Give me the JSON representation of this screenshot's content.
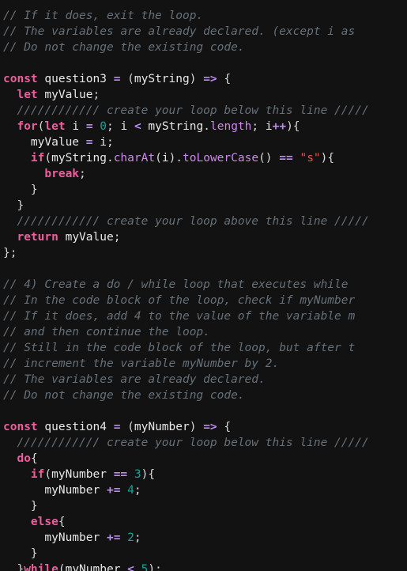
{
  "editor": {
    "background": "#121212",
    "default_text_color": "#d6d6d6",
    "font_size_px": 14.5,
    "line_height_px": 20,
    "theme_colors": {
      "comment": "#667079",
      "keyword": "#ef5d9e",
      "identifier": "#e8e8e8",
      "property": "#c98ae8",
      "operator": "#bb8cf0",
      "number": "#0fa69c",
      "string": "#e2574d",
      "punctuation": "#d8d8d8"
    },
    "lines": [
      {
        "n": 1,
        "indent": 0,
        "tokens": [
          {
            "t": "cmt",
            "v": "// If it does, exit the loop."
          }
        ]
      },
      {
        "n": 2,
        "indent": 0,
        "tokens": [
          {
            "t": "cmt",
            "v": "// The variables are already declared. (except i as"
          }
        ]
      },
      {
        "n": 3,
        "indent": 0,
        "tokens": [
          {
            "t": "cmt",
            "v": "// Do not change the existing code."
          }
        ]
      },
      {
        "n": 4,
        "indent": 0,
        "tokens": []
      },
      {
        "n": 5,
        "indent": 0,
        "tokens": [
          {
            "t": "kw",
            "v": "const"
          },
          {
            "t": "id",
            "v": " question3 "
          },
          {
            "t": "op",
            "v": "="
          },
          {
            "t": "pun",
            "v": " ("
          },
          {
            "t": "id",
            "v": "myString"
          },
          {
            "t": "pun",
            "v": ") "
          },
          {
            "t": "op",
            "v": "=>"
          },
          {
            "t": "pun",
            "v": " {"
          }
        ]
      },
      {
        "n": 6,
        "indent": 1,
        "tokens": [
          {
            "t": "kw",
            "v": "let"
          },
          {
            "t": "id",
            "v": " myValue"
          },
          {
            "t": "pun",
            "v": ";"
          }
        ]
      },
      {
        "n": 7,
        "indent": 1,
        "tokens": [
          {
            "t": "cmt",
            "v": "//////////// create your loop below this line /////"
          }
        ]
      },
      {
        "n": 8,
        "indent": 1,
        "tokens": [
          {
            "t": "kw",
            "v": "for"
          },
          {
            "t": "pun",
            "v": "("
          },
          {
            "t": "kw",
            "v": "let"
          },
          {
            "t": "id",
            "v": " i "
          },
          {
            "t": "op",
            "v": "="
          },
          {
            "t": "id",
            "v": " "
          },
          {
            "t": "num",
            "v": "0"
          },
          {
            "t": "pun",
            "v": "; "
          },
          {
            "t": "id",
            "v": "i "
          },
          {
            "t": "op",
            "v": "<"
          },
          {
            "t": "id",
            "v": " myString"
          },
          {
            "t": "pun",
            "v": "."
          },
          {
            "t": "prop",
            "v": "length"
          },
          {
            "t": "pun",
            "v": "; "
          },
          {
            "t": "id",
            "v": "i"
          },
          {
            "t": "op",
            "v": "++"
          },
          {
            "t": "pun",
            "v": "){"
          }
        ]
      },
      {
        "n": 9,
        "indent": 2,
        "tokens": [
          {
            "t": "id",
            "v": "myValue "
          },
          {
            "t": "op",
            "v": "="
          },
          {
            "t": "id",
            "v": " i"
          },
          {
            "t": "pun",
            "v": ";"
          }
        ]
      },
      {
        "n": 10,
        "indent": 2,
        "tokens": [
          {
            "t": "kw",
            "v": "if"
          },
          {
            "t": "pun",
            "v": "("
          },
          {
            "t": "id",
            "v": "myString"
          },
          {
            "t": "pun",
            "v": "."
          },
          {
            "t": "prop",
            "v": "charAt"
          },
          {
            "t": "pun",
            "v": "("
          },
          {
            "t": "id",
            "v": "i"
          },
          {
            "t": "pun",
            "v": ")."
          },
          {
            "t": "prop",
            "v": "toLowerCase"
          },
          {
            "t": "pun",
            "v": "() "
          },
          {
            "t": "op",
            "v": "=="
          },
          {
            "t": "pun",
            "v": " "
          },
          {
            "t": "str",
            "v": "\"s\""
          },
          {
            "t": "pun",
            "v": "){"
          }
        ]
      },
      {
        "n": 11,
        "indent": 3,
        "tokens": [
          {
            "t": "kw",
            "v": "break"
          },
          {
            "t": "pun",
            "v": ";"
          }
        ]
      },
      {
        "n": 12,
        "indent": 2,
        "tokens": [
          {
            "t": "pun",
            "v": "}"
          }
        ]
      },
      {
        "n": 13,
        "indent": 1,
        "tokens": [
          {
            "t": "pun",
            "v": "}"
          }
        ]
      },
      {
        "n": 14,
        "indent": 1,
        "tokens": [
          {
            "t": "cmt",
            "v": "//////////// create your loop above this line /////"
          }
        ]
      },
      {
        "n": 15,
        "indent": 1,
        "tokens": [
          {
            "t": "kw",
            "v": "return"
          },
          {
            "t": "id",
            "v": " myValue"
          },
          {
            "t": "pun",
            "v": ";"
          }
        ]
      },
      {
        "n": 16,
        "indent": 0,
        "tokens": [
          {
            "t": "pun",
            "v": "};"
          }
        ]
      },
      {
        "n": 17,
        "indent": 0,
        "tokens": []
      },
      {
        "n": 18,
        "indent": 0,
        "tokens": [
          {
            "t": "cmt",
            "v": "// 4) Create a do / while loop that executes while"
          }
        ]
      },
      {
        "n": 19,
        "indent": 0,
        "tokens": [
          {
            "t": "cmt",
            "v": "// In the code block of the loop, check if myNumber"
          }
        ]
      },
      {
        "n": 20,
        "indent": 0,
        "tokens": [
          {
            "t": "cmt",
            "v": "// If it does, add 4 to the value of the variable m"
          }
        ]
      },
      {
        "n": 21,
        "indent": 0,
        "tokens": [
          {
            "t": "cmt",
            "v": "// and then continue the loop."
          }
        ]
      },
      {
        "n": 22,
        "indent": 0,
        "tokens": [
          {
            "t": "cmt",
            "v": "// Still in the code block of the loop, but after t"
          }
        ]
      },
      {
        "n": 23,
        "indent": 0,
        "tokens": [
          {
            "t": "cmt",
            "v": "// increment the variable myNumber by 2."
          }
        ]
      },
      {
        "n": 24,
        "indent": 0,
        "tokens": [
          {
            "t": "cmt",
            "v": "// The variables are already declared."
          }
        ]
      },
      {
        "n": 25,
        "indent": 0,
        "tokens": [
          {
            "t": "cmt",
            "v": "// Do not change the existing code."
          }
        ]
      },
      {
        "n": 26,
        "indent": 0,
        "tokens": []
      },
      {
        "n": 27,
        "indent": 0,
        "tokens": [
          {
            "t": "kw",
            "v": "const"
          },
          {
            "t": "id",
            "v": " question4 "
          },
          {
            "t": "op",
            "v": "="
          },
          {
            "t": "pun",
            "v": " ("
          },
          {
            "t": "id",
            "v": "myNumber"
          },
          {
            "t": "pun",
            "v": ") "
          },
          {
            "t": "op",
            "v": "=>"
          },
          {
            "t": "pun",
            "v": " {"
          }
        ]
      },
      {
        "n": 28,
        "indent": 1,
        "tokens": [
          {
            "t": "cmt",
            "v": "//////////// create your loop below this line /////"
          }
        ]
      },
      {
        "n": 29,
        "indent": 1,
        "tokens": [
          {
            "t": "kw",
            "v": "do"
          },
          {
            "t": "pun",
            "v": "{"
          }
        ]
      },
      {
        "n": 30,
        "indent": 2,
        "tokens": [
          {
            "t": "kw",
            "v": "if"
          },
          {
            "t": "pun",
            "v": "("
          },
          {
            "t": "id",
            "v": "myNumber "
          },
          {
            "t": "op",
            "v": "=="
          },
          {
            "t": "pun",
            "v": " "
          },
          {
            "t": "num",
            "v": "3"
          },
          {
            "t": "pun",
            "v": "){"
          }
        ]
      },
      {
        "n": 31,
        "indent": 3,
        "tokens": [
          {
            "t": "id",
            "v": "myNumber "
          },
          {
            "t": "op",
            "v": "+="
          },
          {
            "t": "pun",
            "v": " "
          },
          {
            "t": "num",
            "v": "4"
          },
          {
            "t": "pun",
            "v": ";"
          }
        ]
      },
      {
        "n": 32,
        "indent": 2,
        "tokens": [
          {
            "t": "pun",
            "v": "}"
          }
        ]
      },
      {
        "n": 33,
        "indent": 2,
        "tokens": [
          {
            "t": "kw",
            "v": "else"
          },
          {
            "t": "pun",
            "v": "{"
          }
        ]
      },
      {
        "n": 34,
        "indent": 3,
        "tokens": [
          {
            "t": "id",
            "v": "myNumber "
          },
          {
            "t": "op",
            "v": "+="
          },
          {
            "t": "pun",
            "v": " "
          },
          {
            "t": "num",
            "v": "2"
          },
          {
            "t": "pun",
            "v": ";"
          }
        ]
      },
      {
        "n": 35,
        "indent": 2,
        "tokens": [
          {
            "t": "pun",
            "v": "}"
          }
        ]
      },
      {
        "n": 36,
        "indent": 1,
        "tokens": [
          {
            "t": "pun",
            "v": "}"
          },
          {
            "t": "kw",
            "v": "while"
          },
          {
            "t": "pun",
            "v": "("
          },
          {
            "t": "id",
            "v": "myNumber "
          },
          {
            "t": "op",
            "v": "<"
          },
          {
            "t": "pun",
            "v": " "
          },
          {
            "t": "num",
            "v": "5"
          },
          {
            "t": "pun",
            "v": ");"
          }
        ]
      }
    ]
  }
}
